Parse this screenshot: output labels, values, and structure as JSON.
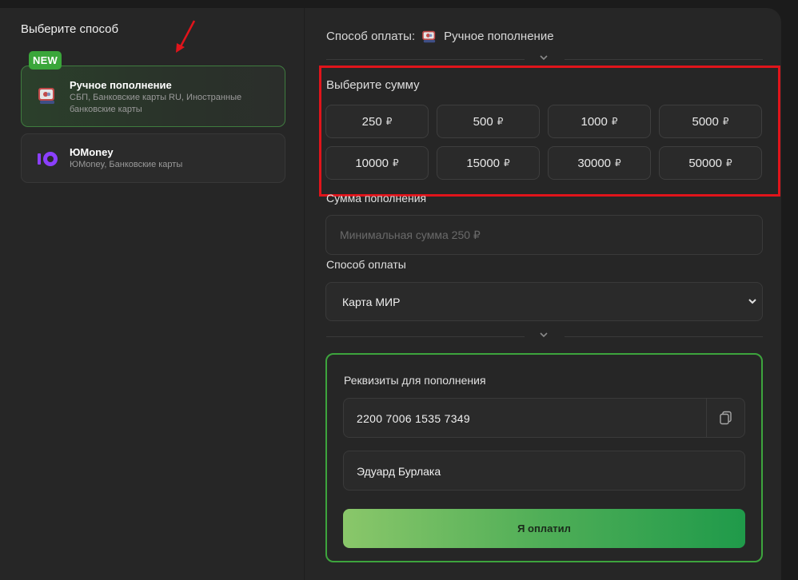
{
  "left": {
    "title": "Выберите способ",
    "methods": [
      {
        "badge": "NEW",
        "title": "Ручное пополнение",
        "subtitle": "СБП, Банковские карты RU, Иностранные банковские карты"
      },
      {
        "title": "ЮMoney",
        "subtitle": "ЮMoney, Банковские карты"
      }
    ]
  },
  "header": {
    "label": "Способ оплаты:",
    "method": "Ручное пополнение"
  },
  "amounts": {
    "title": "Выберите сумму",
    "currency": "₽",
    "options": [
      "250",
      "500",
      "1000",
      "5000",
      "10000",
      "15000",
      "30000",
      "50000"
    ]
  },
  "sum_field": {
    "label": "Сумма пополнения",
    "placeholder": "Минимальная сумма 250 ₽",
    "value": ""
  },
  "payment_method": {
    "label": "Способ оплаты",
    "selected": "Карта МИР"
  },
  "requisites": {
    "title": "Реквизиты для пополнения",
    "card_number": "2200 7006 1535 7349",
    "recipient": "Эдуард Бурлака",
    "confirm_label": "Я оплатил"
  },
  "colors": {
    "accent_green": "#3da43d",
    "highlight_red": "#e0141b",
    "yoomoney_purple": "#8b3ffd"
  }
}
